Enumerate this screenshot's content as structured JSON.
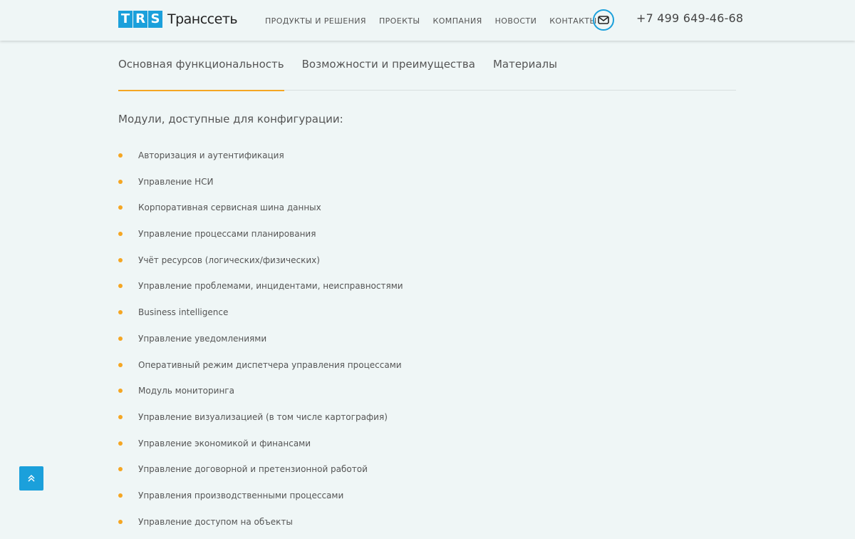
{
  "brand": {
    "logo_letters": [
      "T",
      "R",
      "S"
    ],
    "name": "Транссеть",
    "accent_color": "#1ba0db",
    "highlight_color": "#f5a623"
  },
  "nav": {
    "items": [
      {
        "label": "Продукты и решения"
      },
      {
        "label": "Проекты"
      },
      {
        "label": "Компания"
      },
      {
        "label": "Новости"
      },
      {
        "label": "Контакты"
      }
    ]
  },
  "header": {
    "mail_icon": "envelope-icon",
    "phone": "+7 499 649-46-68"
  },
  "tabs": [
    {
      "label": "Основная функциональность",
      "active": true
    },
    {
      "label": "Возможности и преимущества",
      "active": false
    },
    {
      "label": "Материалы",
      "active": false
    }
  ],
  "content": {
    "title": "Модули, доступные для конфигурации:",
    "modules": [
      "Авторизация и аутентификация",
      "Управление НСИ",
      "Корпоративная сервисная шина данных",
      "Управление процессами планирования",
      "Учёт ресурсов (логических/физических)",
      "Управление проблемами, инцидентами, неисправностями",
      "Business intelligence",
      "Управление уведомлениями",
      "Оперативный режим диспетчера управления процессами",
      "Модуль мониторинга",
      "Управление визуализацией (в том числе картография)",
      "Управление экономикой и финансами",
      "Управление договорной и претензионной работой",
      "Управления производственными процессами",
      "Управление доступом на объекты"
    ]
  },
  "scroll_top": {
    "icon": "double-chevron-up-icon"
  }
}
